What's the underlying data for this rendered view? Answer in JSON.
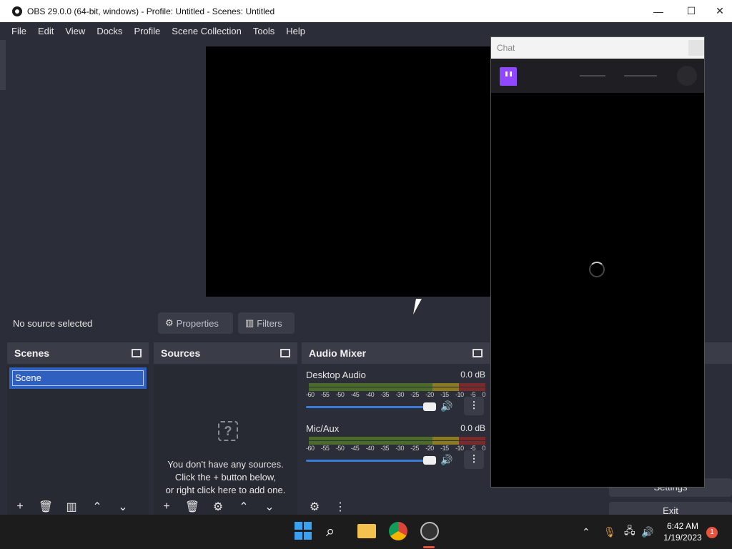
{
  "window": {
    "title": "OBS 29.0.0 (64-bit, windows) - Profile: Untitled - Scenes: Untitled",
    "minimize_icon": "—",
    "maximize_icon": "☐",
    "close_icon": "✕"
  },
  "menu": [
    "File",
    "Edit",
    "View",
    "Docks",
    "Profile",
    "Scene Collection",
    "Tools",
    "Help"
  ],
  "status": {
    "no_source": "No source selected",
    "properties": "Properties",
    "filters": "Filters"
  },
  "scenes": {
    "title": "Scenes",
    "items": [
      "Scene"
    ]
  },
  "sources": {
    "title": "Sources",
    "empty_line1": "You don't have any sources.",
    "empty_line2": "Click the + button below,",
    "empty_line3": "or right click here to add one."
  },
  "mixer": {
    "title": "Audio Mixer",
    "scale": [
      "-60",
      "-55",
      "-50",
      "-45",
      "-40",
      "-35",
      "-30",
      "-25",
      "-20",
      "-15",
      "-10",
      "-5",
      "0"
    ],
    "tracks": [
      {
        "name": "Desktop Audio",
        "db": "0.0 dB",
        "volume": 1.0
      },
      {
        "name": "Mic/Aux",
        "db": "0.0 dB",
        "volume": 1.0
      }
    ]
  },
  "chat": {
    "title": "Chat"
  },
  "controls": {
    "settings": "Settings",
    "exit": "Exit"
  },
  "taskbar": {
    "time": "6:42 AM",
    "date": "1/19/2023",
    "notifications": "1"
  },
  "colors": {
    "accent": "#2f5fbf",
    "twitch": "#9146ff"
  }
}
